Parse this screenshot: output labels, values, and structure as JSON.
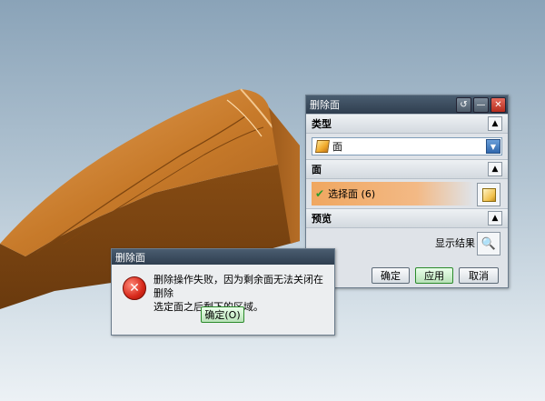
{
  "panel": {
    "title": "删除面",
    "buttons": {
      "reset_icon": "reset-icon",
      "minimize_icon": "minimize-icon",
      "close_icon": "close-icon"
    },
    "section_type": {
      "label": "类型",
      "select_value": "面"
    },
    "section_face": {
      "label": "面",
      "select_label": "选择面 (6)"
    },
    "section_preview": {
      "label": "预览",
      "show_result_label": "显示结果"
    },
    "footer": {
      "ok": "确定",
      "apply": "应用",
      "cancel": "取消"
    }
  },
  "error_dialog": {
    "title": "删除面",
    "message_line1": "删除操作失败，因为剩余面无法关闭在删除",
    "message_line2": "选定面之后剩下的区域。",
    "ok_label": "确定(O)"
  },
  "colors": {
    "model": "#c77a2a",
    "apply_border": "#2b8a2b",
    "error_red": "#d6281a"
  }
}
